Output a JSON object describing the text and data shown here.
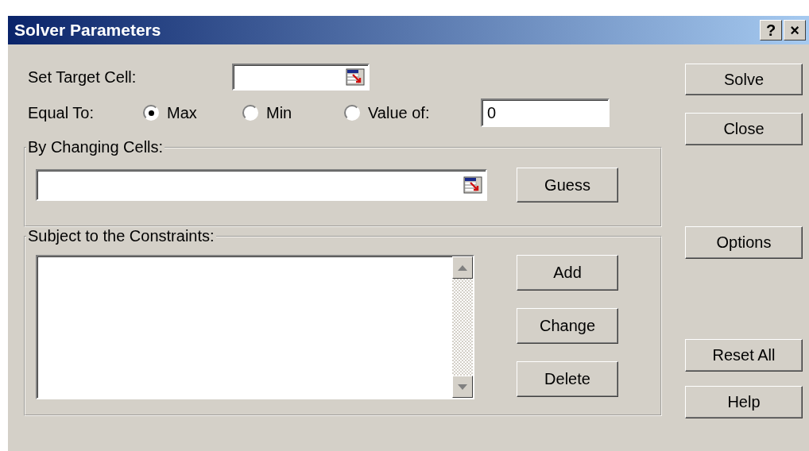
{
  "window": {
    "title": "Solver Parameters",
    "controls": [
      "?",
      "×"
    ]
  },
  "target_cell": {
    "label": "Set Target Cell:"
  },
  "equal_to": {
    "label": "Equal To:",
    "options": [
      {
        "label": "Max",
        "selected": true
      },
      {
        "label": "Min",
        "selected": false
      },
      {
        "label": "Value of:",
        "selected": false
      }
    ],
    "value": "0"
  },
  "changing_cells": {
    "label": "By Changing Cells:",
    "button": "Guess"
  },
  "constraints": {
    "label": "Subject to the Constraints:",
    "buttons": [
      "Add",
      "Change",
      "Delete"
    ]
  },
  "side_buttons": [
    "Solve",
    "Close",
    "Options",
    "Reset All",
    "Help"
  ]
}
